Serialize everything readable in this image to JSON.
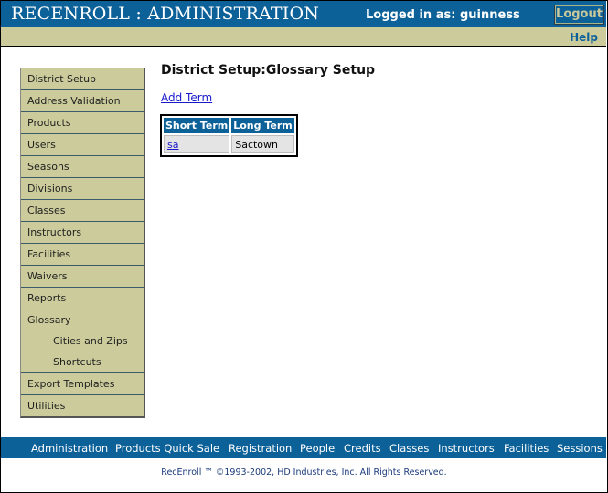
{
  "header": {
    "app_title": "RECENROLL : ADMINISTRATION",
    "logged_in_text": "Logged in as: guinness",
    "logout_label": "Logout",
    "help_label": "Help"
  },
  "sidebar": {
    "items": [
      {
        "label": "District Setup"
      },
      {
        "label": "Address Validation"
      },
      {
        "label": "Products"
      },
      {
        "label": "Users"
      },
      {
        "label": "Seasons"
      },
      {
        "label": "Divisions"
      },
      {
        "label": "Classes"
      },
      {
        "label": "Instructors"
      },
      {
        "label": "Facilities"
      },
      {
        "label": "Waivers"
      },
      {
        "label": "Reports"
      },
      {
        "label": "Glossary"
      }
    ],
    "glossary_subitems": [
      {
        "label": "Cities and Zips"
      },
      {
        "label": "Shortcuts"
      }
    ],
    "bottom_items": [
      {
        "label": "Export Templates"
      },
      {
        "label": "Utilities"
      }
    ]
  },
  "main": {
    "page_title": "District Setup:Glossary Setup",
    "add_term_label": "Add Term",
    "table": {
      "headers": [
        "Short Term",
        "Long Term"
      ],
      "rows": [
        {
          "short": "sa",
          "long": "Sactown"
        }
      ]
    }
  },
  "footer": {
    "nav": [
      "Administration",
      "Products Quick Sale",
      "Registration",
      "People",
      "Credits",
      "Classes",
      "Instructors",
      "Facilities",
      "Sessions"
    ],
    "copyright": "RecEnroll ™ ©1993-2002,  HD Industries, Inc.  All Rights Reserved."
  },
  "colors": {
    "brand_blue": "#0d6199",
    "khaki": "#cbcb9b",
    "link_blue": "#1a1acc"
  }
}
